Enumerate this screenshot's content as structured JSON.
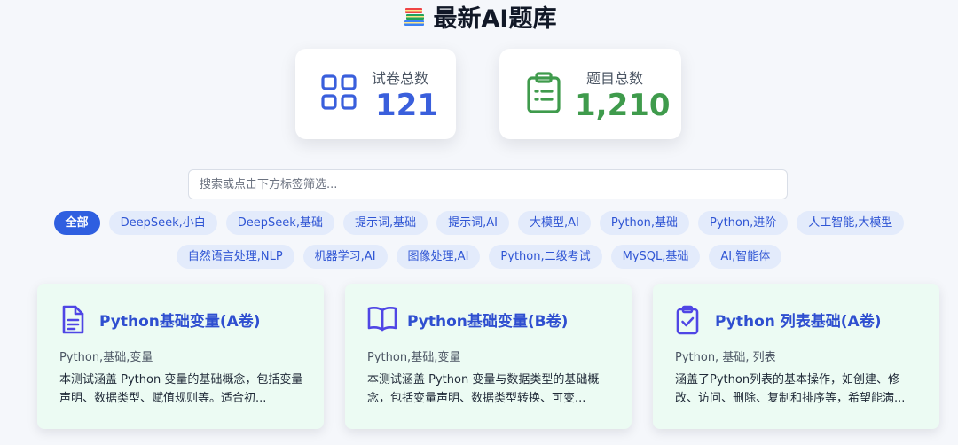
{
  "header": {
    "title": "最新AI题库",
    "icon": "books-icon"
  },
  "stats": {
    "papers": {
      "label": "试卷总数",
      "value": "121",
      "icon": "grid-icon",
      "color": "#3a5fdc"
    },
    "questions": {
      "label": "题目总数",
      "value": "1,210",
      "icon": "clipboard-icon",
      "color": "#3f9b4c"
    }
  },
  "search": {
    "placeholder": "搜索或点击下方标签筛选...",
    "value": ""
  },
  "tags": {
    "row1": [
      {
        "label": "全部",
        "active": true
      },
      {
        "label": "DeepSeek,小白"
      },
      {
        "label": "DeepSeek,基础"
      },
      {
        "label": "提示词,基础"
      },
      {
        "label": "提示词,AI"
      },
      {
        "label": "大模型,AI"
      },
      {
        "label": "Python,基础"
      },
      {
        "label": "Python,进阶"
      },
      {
        "label": "人工智能,大模型"
      }
    ],
    "row2": [
      {
        "label": "自然语言处理,NLP"
      },
      {
        "label": "机器学习,AI"
      },
      {
        "label": "图像处理,AI"
      },
      {
        "label": "Python,二级考试"
      },
      {
        "label": "MySQL,基础"
      },
      {
        "label": "AI,智能体"
      }
    ]
  },
  "cards": [
    {
      "icon": "document-icon",
      "title": "Python基础变量(A卷)",
      "tags": "Python,基础,变量",
      "description": "本测试涵盖 Python 变量的基础概念，包括变量声明、数据类型、赋值规则等。适合初..."
    },
    {
      "icon": "open-book-icon",
      "title": "Python基础变量(B卷)",
      "tags": "Python,基础,变量",
      "description": "本测试涵盖 Python 变量与数据类型的基础概念，包括变量声明、数据类型转换、可变..."
    },
    {
      "icon": "clipboard-check-icon",
      "title": "Python 列表基础(A卷)",
      "tags": "Python, 基础, 列表",
      "description": "涵盖了Python列表的基本操作，如创建、修改、访问、删除、复制和排序等，希望能满..."
    }
  ]
}
